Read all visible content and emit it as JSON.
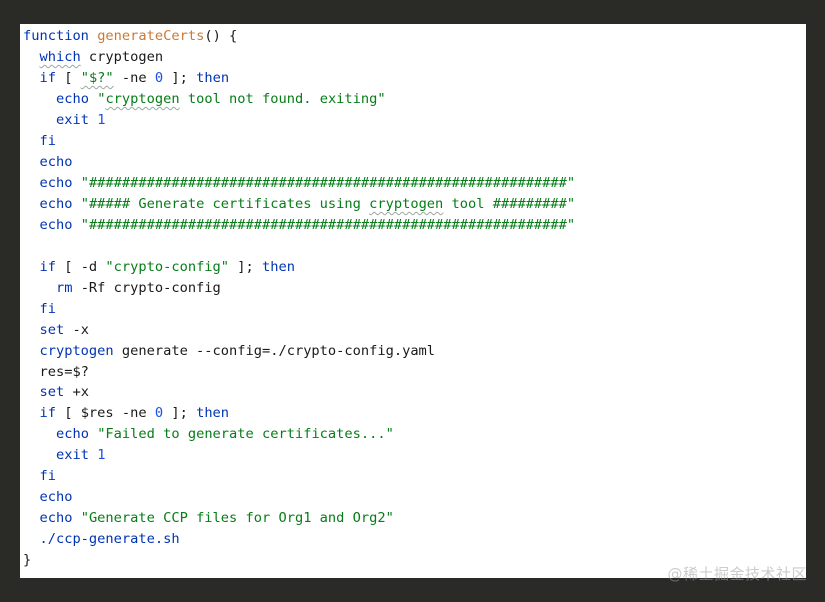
{
  "colors": {
    "background": "#2a2a27",
    "editor_bg": "#ffffff",
    "keyword": "#0033b3",
    "function_name": "#cc7832",
    "string": "#067d17",
    "number": "#1750eb",
    "text": "#1a1a1a"
  },
  "code": {
    "lines": [
      [
        {
          "t": "function",
          "c": "kw"
        },
        {
          "t": " ",
          "c": "plain"
        },
        {
          "t": "generateCerts",
          "c": "fn"
        },
        {
          "t": "() {",
          "c": "plain"
        }
      ],
      [
        {
          "t": "  ",
          "c": "plain"
        },
        {
          "t": "which",
          "c": "kw",
          "s": true
        },
        {
          "t": " cryptogen",
          "c": "plain"
        }
      ],
      [
        {
          "t": "  ",
          "c": "plain"
        },
        {
          "t": "if",
          "c": "kw"
        },
        {
          "t": " [ ",
          "c": "plain"
        },
        {
          "t": "\"$?\"",
          "c": "str",
          "s": true
        },
        {
          "t": " -ne ",
          "c": "plain"
        },
        {
          "t": "0",
          "c": "num"
        },
        {
          "t": " ]; ",
          "c": "plain"
        },
        {
          "t": "then",
          "c": "kw"
        }
      ],
      [
        {
          "t": "    ",
          "c": "plain"
        },
        {
          "t": "echo",
          "c": "kw"
        },
        {
          "t": " ",
          "c": "plain"
        },
        {
          "t": "\"",
          "c": "str"
        },
        {
          "t": "cryptogen",
          "c": "str",
          "s": true
        },
        {
          "t": " tool not found. exiting\"",
          "c": "str"
        }
      ],
      [
        {
          "t": "    ",
          "c": "plain"
        },
        {
          "t": "exit",
          "c": "kw"
        },
        {
          "t": " ",
          "c": "plain"
        },
        {
          "t": "1",
          "c": "num"
        }
      ],
      [
        {
          "t": "  ",
          "c": "plain"
        },
        {
          "t": "fi",
          "c": "kw"
        }
      ],
      [
        {
          "t": "  ",
          "c": "plain"
        },
        {
          "t": "echo",
          "c": "kw"
        }
      ],
      [
        {
          "t": "  ",
          "c": "plain"
        },
        {
          "t": "echo",
          "c": "kw"
        },
        {
          "t": " ",
          "c": "plain"
        },
        {
          "t": "\"##########################################################\"",
          "c": "str"
        }
      ],
      [
        {
          "t": "  ",
          "c": "plain"
        },
        {
          "t": "echo",
          "c": "kw"
        },
        {
          "t": " ",
          "c": "plain"
        },
        {
          "t": "\"##### Generate certificates using ",
          "c": "str"
        },
        {
          "t": "cryptogen",
          "c": "str",
          "s": true
        },
        {
          "t": " tool #########\"",
          "c": "str"
        }
      ],
      [
        {
          "t": "  ",
          "c": "plain"
        },
        {
          "t": "echo",
          "c": "kw"
        },
        {
          "t": " ",
          "c": "plain"
        },
        {
          "t": "\"##########################################################\"",
          "c": "str"
        }
      ],
      [
        {
          "t": "",
          "c": "plain"
        }
      ],
      [
        {
          "t": "  ",
          "c": "plain"
        },
        {
          "t": "if",
          "c": "kw"
        },
        {
          "t": " [ -d ",
          "c": "plain"
        },
        {
          "t": "\"crypto-config\"",
          "c": "str"
        },
        {
          "t": " ]; ",
          "c": "plain"
        },
        {
          "t": "then",
          "c": "kw"
        }
      ],
      [
        {
          "t": "    ",
          "c": "plain"
        },
        {
          "t": "rm",
          "c": "kw"
        },
        {
          "t": " -Rf crypto-config",
          "c": "plain"
        }
      ],
      [
        {
          "t": "  ",
          "c": "plain"
        },
        {
          "t": "fi",
          "c": "kw"
        }
      ],
      [
        {
          "t": "  ",
          "c": "plain"
        },
        {
          "t": "set",
          "c": "kw"
        },
        {
          "t": " -x",
          "c": "plain"
        }
      ],
      [
        {
          "t": "  ",
          "c": "plain"
        },
        {
          "t": "cryptogen",
          "c": "kw"
        },
        {
          "t": " generate --config=./crypto-config.yaml",
          "c": "plain"
        }
      ],
      [
        {
          "t": "  res=$?",
          "c": "plain"
        }
      ],
      [
        {
          "t": "  ",
          "c": "plain"
        },
        {
          "t": "set",
          "c": "kw"
        },
        {
          "t": " +x",
          "c": "plain"
        }
      ],
      [
        {
          "t": "  ",
          "c": "plain"
        },
        {
          "t": "if",
          "c": "kw"
        },
        {
          "t": " [ $res -ne ",
          "c": "plain"
        },
        {
          "t": "0",
          "c": "num"
        },
        {
          "t": " ]; ",
          "c": "plain"
        },
        {
          "t": "then",
          "c": "kw"
        }
      ],
      [
        {
          "t": "    ",
          "c": "plain"
        },
        {
          "t": "echo",
          "c": "kw"
        },
        {
          "t": " ",
          "c": "plain"
        },
        {
          "t": "\"Failed to generate certificates...\"",
          "c": "str"
        }
      ],
      [
        {
          "t": "    ",
          "c": "plain"
        },
        {
          "t": "exit",
          "c": "kw"
        },
        {
          "t": " ",
          "c": "plain"
        },
        {
          "t": "1",
          "c": "num"
        }
      ],
      [
        {
          "t": "  ",
          "c": "plain"
        },
        {
          "t": "fi",
          "c": "kw"
        }
      ],
      [
        {
          "t": "  ",
          "c": "plain"
        },
        {
          "t": "echo",
          "c": "kw"
        }
      ],
      [
        {
          "t": "  ",
          "c": "plain"
        },
        {
          "t": "echo",
          "c": "kw"
        },
        {
          "t": " ",
          "c": "plain"
        },
        {
          "t": "\"Generate CCP files for Org1 and Org2\"",
          "c": "str"
        }
      ],
      [
        {
          "t": "  ",
          "c": "plain"
        },
        {
          "t": "./ccp-generate.sh",
          "c": "kw"
        }
      ],
      [
        {
          "t": "}",
          "c": "plain"
        }
      ]
    ]
  },
  "watermark": {
    "text": "@稀土掘金技术社区"
  }
}
